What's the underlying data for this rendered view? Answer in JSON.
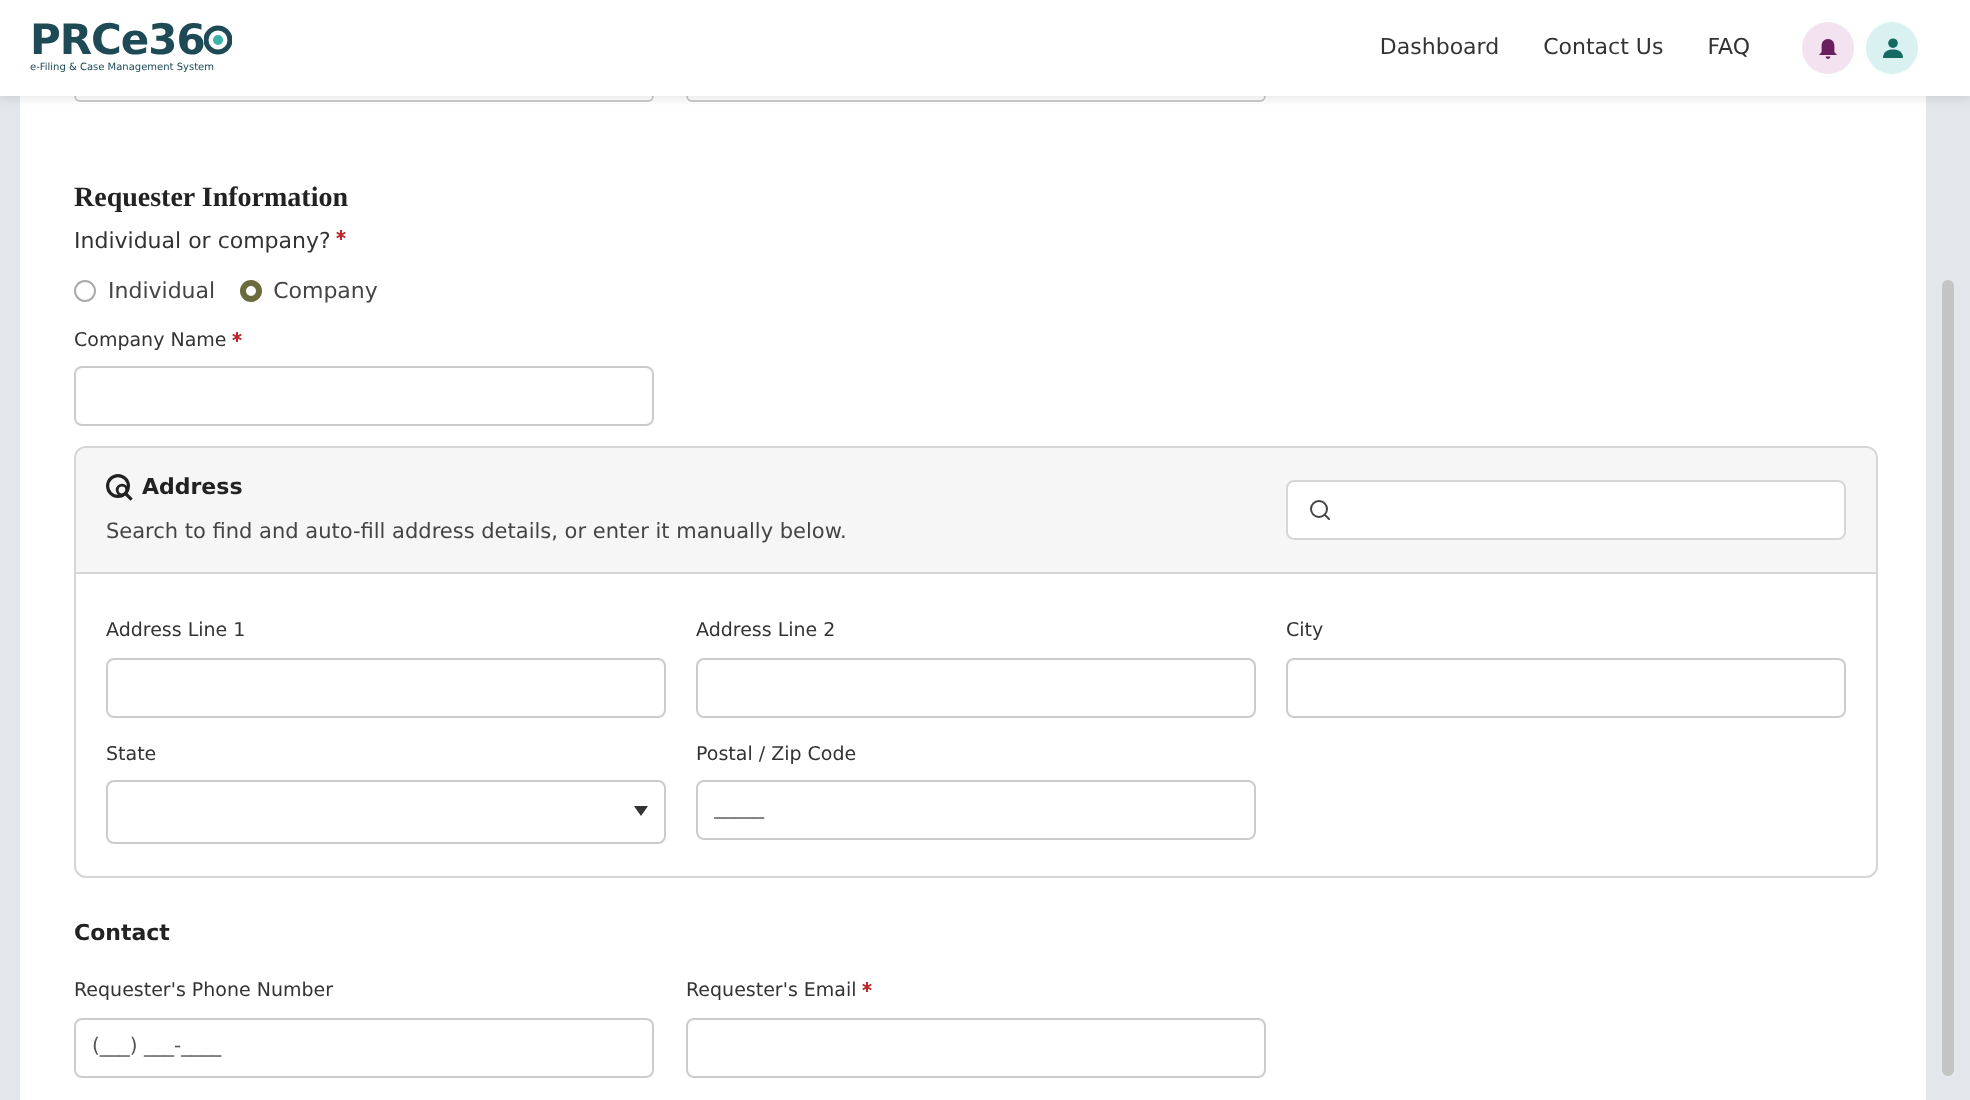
{
  "header": {
    "logo": {
      "text": "PRCe36",
      "tagline": "e-Filing & Case Management System"
    },
    "nav": [
      "Dashboard",
      "Contact Us",
      "FAQ"
    ]
  },
  "requester": {
    "title": "Requester Information",
    "question": {
      "label": "Individual or company?",
      "required": true
    },
    "options": [
      {
        "label": "Individual",
        "selected": false
      },
      {
        "label": "Company",
        "selected": true
      }
    ],
    "company_name": {
      "label": "Company Name",
      "required": true
    }
  },
  "address": {
    "title": "Address",
    "description": "Search to find and auto-fill address details, or enter it manually below.",
    "fields": [
      {
        "label": "Address Line 1",
        "kind": "text"
      },
      {
        "label": "Address Line 2",
        "kind": "text"
      },
      {
        "label": "City",
        "kind": "text"
      },
      {
        "label": "State",
        "kind": "select"
      },
      {
        "label": "Postal / Zip Code",
        "kind": "masked",
        "value": "_____"
      }
    ]
  },
  "contact": {
    "title": "Contact",
    "fields": [
      {
        "label": "Requester's Phone Number",
        "required": false,
        "value": "(___) ___-____"
      },
      {
        "label": "Requester's Email",
        "required": true
      }
    ]
  }
}
